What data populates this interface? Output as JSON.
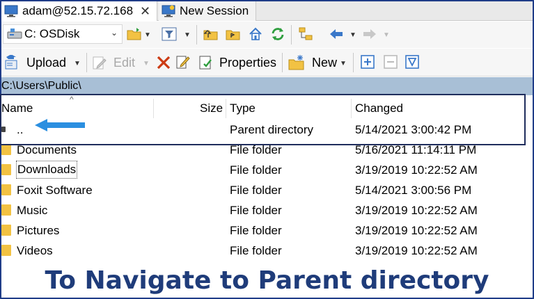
{
  "tabs": [
    {
      "label": "adam@52.15.72.168",
      "active": true
    },
    {
      "label": "New Session",
      "active": false
    }
  ],
  "toolbar1": {
    "drive_label": "C: OSDisk"
  },
  "toolbar2": {
    "upload_label": "Upload",
    "edit_label": "Edit",
    "properties_label": "Properties",
    "new_label": "New"
  },
  "path": "C:\\Users\\Public\\",
  "columns": {
    "name": "Name",
    "size": "Size",
    "type": "Type",
    "changed": "Changed"
  },
  "rows": [
    {
      "name": "..",
      "size": "",
      "type": "Parent directory",
      "changed": "5/14/2021  3:00:42 PM"
    },
    {
      "name": "Documents",
      "size": "",
      "type": "File folder",
      "changed": "5/16/2021  11:14:11 PM"
    },
    {
      "name": "Downloads",
      "size": "",
      "type": "File folder",
      "changed": "3/19/2019  10:22:52 AM"
    },
    {
      "name": "Foxit Software",
      "size": "",
      "type": "File folder",
      "changed": "5/14/2021  3:00:56 PM"
    },
    {
      "name": "Music",
      "size": "",
      "type": "File folder",
      "changed": "3/19/2019  10:22:52 AM"
    },
    {
      "name": "Pictures",
      "size": "",
      "type": "File folder",
      "changed": "3/19/2019  10:22:52 AM"
    },
    {
      "name": "Videos",
      "size": "",
      "type": "File folder",
      "changed": "3/19/2019  10:22:52 AM"
    }
  ],
  "caption": "To Navigate to Parent directory",
  "colors": {
    "accent": "#1f3c88",
    "path_bar": "#a8bfd6",
    "folder": "#f2c243",
    "arrow": "#2b8fe0"
  }
}
